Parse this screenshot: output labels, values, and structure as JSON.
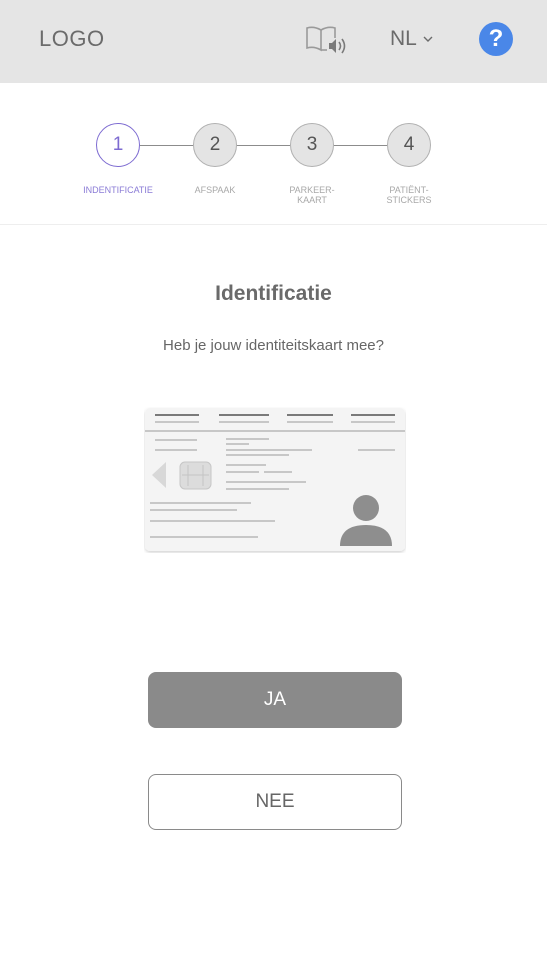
{
  "header": {
    "logo": "LOGO",
    "read_aloud_icon": "book-speaker-icon",
    "language": "NL",
    "help_label": "?",
    "help_color": "#4a87e8",
    "background": "#e5e5e5"
  },
  "stepper": {
    "active_step": 1,
    "accent_color": "#7d6bd1",
    "steps": [
      {
        "number": "1",
        "label": "INDENTIFICATIE"
      },
      {
        "number": "2",
        "label": "AFSPAAK"
      },
      {
        "number": "3",
        "label": "PARKEER-\nKAART"
      },
      {
        "number": "4",
        "label": "PATIËNT-\nSTICKERS"
      }
    ]
  },
  "main": {
    "title": "Identificatie",
    "question": "Heb je jouw identiteitskaart mee?",
    "illustration_icon": "id-card-icon"
  },
  "actions": {
    "yes_label": "JA",
    "no_label": "NEE"
  }
}
